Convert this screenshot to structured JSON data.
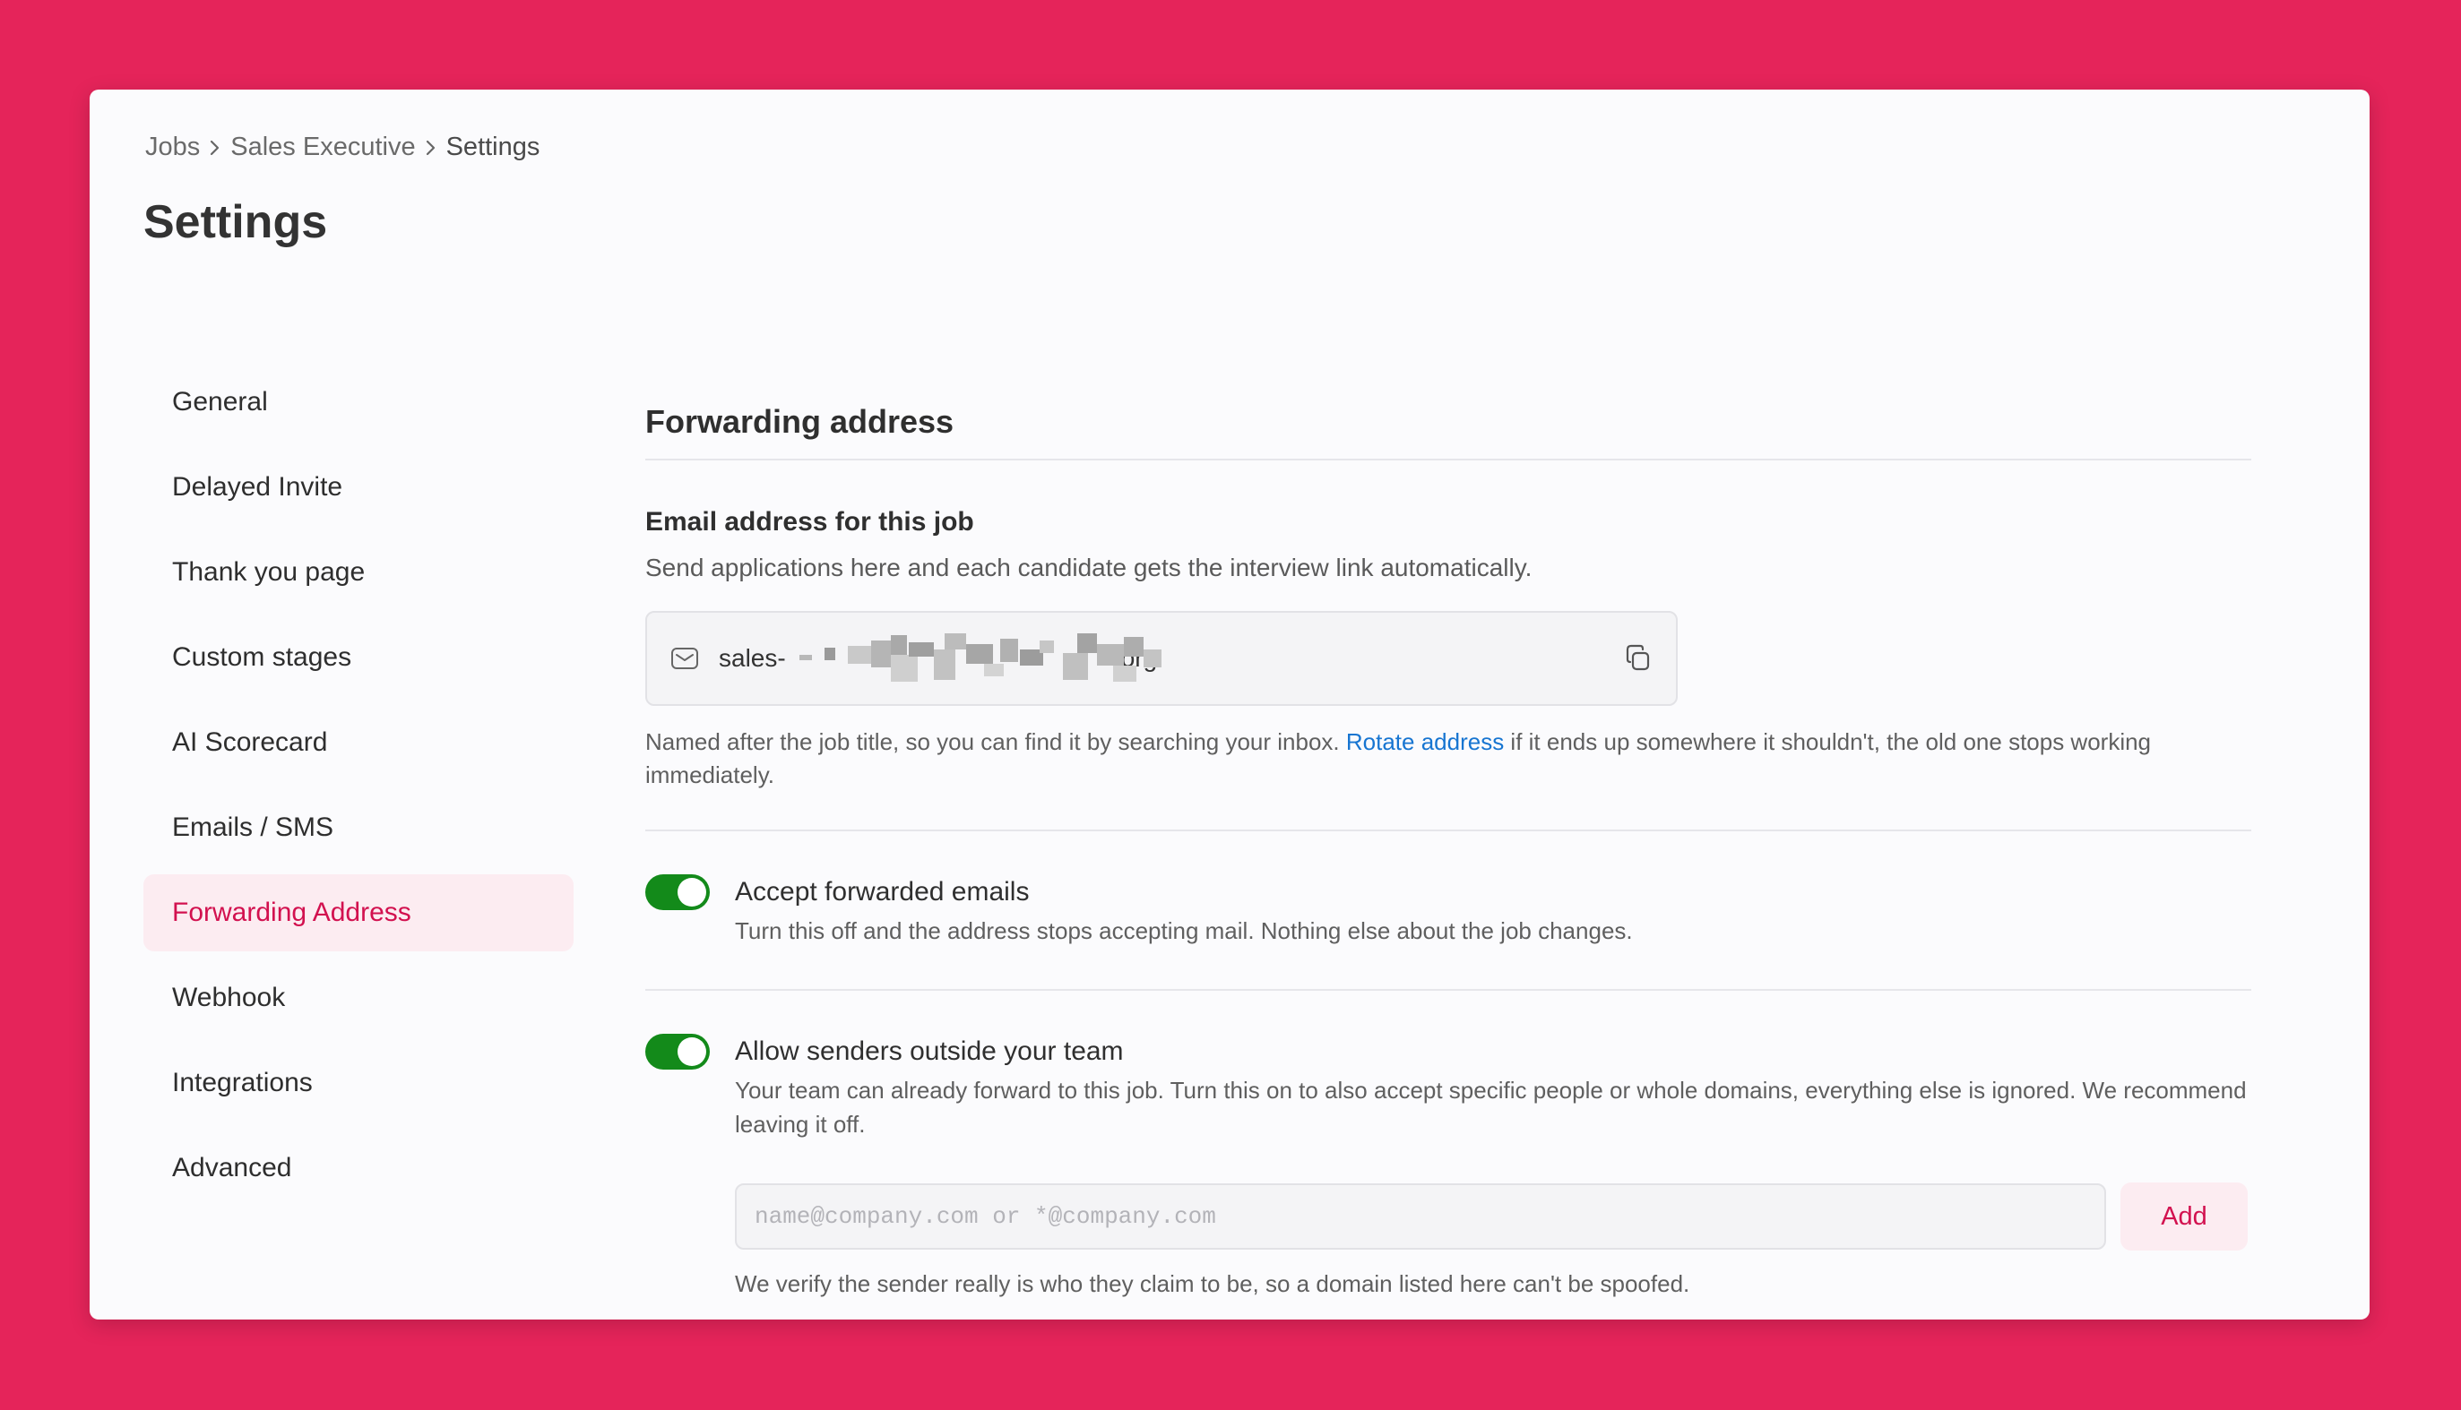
{
  "colors": {
    "background": "#e5245a",
    "accent": "#d2114f",
    "accent_bg": "#fcecf1",
    "toggle_on": "#138a1a",
    "link": "#1775d1"
  },
  "breadcrumb": {
    "items": [
      "Jobs",
      "Sales Executive",
      "Settings"
    ],
    "separator_icon": "chevron-right-icon"
  },
  "page": {
    "title": "Settings"
  },
  "sidebar": {
    "items": [
      {
        "label": "General",
        "active": false
      },
      {
        "label": "Delayed Invite",
        "active": false
      },
      {
        "label": "Thank you page",
        "active": false
      },
      {
        "label": "Custom stages",
        "active": false
      },
      {
        "label": "AI Scorecard",
        "active": false
      },
      {
        "label": "Emails / SMS",
        "active": false
      },
      {
        "label": "Forwarding Address",
        "active": true
      },
      {
        "label": "Webhook",
        "active": false
      },
      {
        "label": "Integrations",
        "active": false
      },
      {
        "label": "Advanced",
        "active": false
      }
    ]
  },
  "section": {
    "title": "Forwarding address",
    "email": {
      "label": "Email address for this job",
      "help": "Send applications here and each candidate gets the interview link automatically.",
      "icon": "envelope-icon",
      "value_prefix": "sales-",
      "value_suffix": "org",
      "copy_icon": "copy-icon",
      "note_before": "Named after the job title, so you can find it by searching your inbox. ",
      "note_link": "Rotate address",
      "note_after": " if it ends up somewhere it shouldn't, the old one stops working immediately."
    },
    "accept": {
      "enabled": true,
      "title": "Accept forwarded emails",
      "description": "Turn this off and the address stops accepting mail. Nothing else about the job changes."
    },
    "outside": {
      "enabled": true,
      "title": "Allow senders outside your team",
      "description": "Your team can already forward to this job. Turn this on to also accept specific people or whole domains, everything else is ignored. We recommend leaving it off.",
      "input_placeholder": "name@company.com or *@company.com",
      "add_label": "Add",
      "note": "We verify the sender really is who they claim to be, so a domain listed here can't be spoofed."
    }
  }
}
